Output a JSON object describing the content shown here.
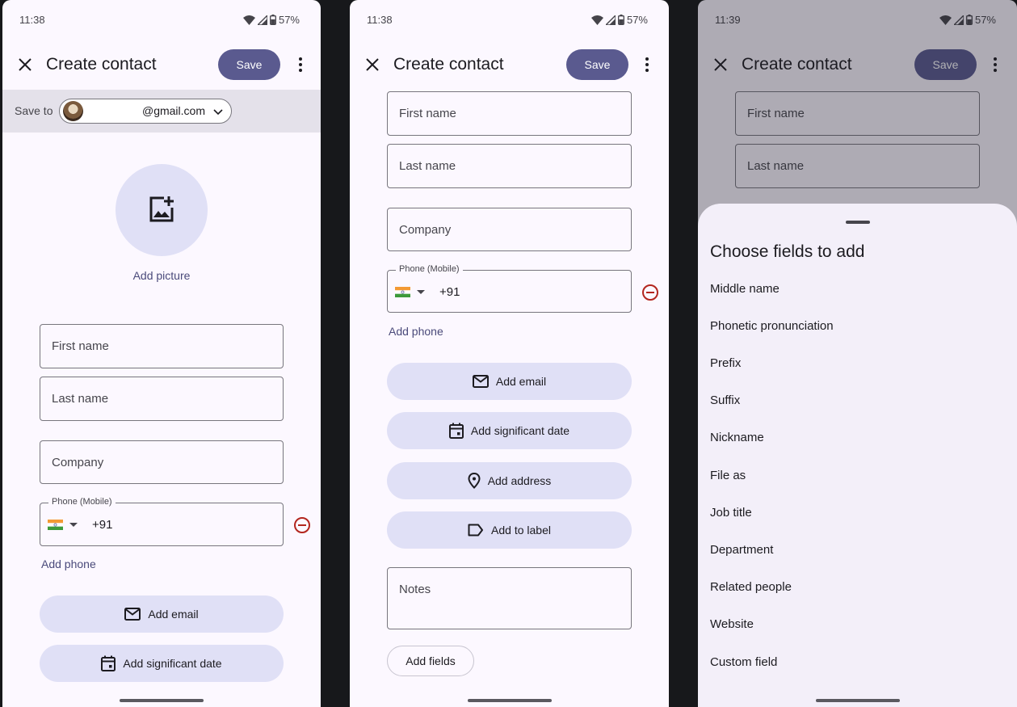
{
  "screens": [
    {
      "status": {
        "time": "11:38",
        "battery": "57%"
      },
      "appbar": {
        "title": "Create contact",
        "save_label": "Save"
      },
      "save_to": {
        "label": "Save to",
        "account": "@gmail.com"
      },
      "add_picture_label": "Add picture",
      "fields": {
        "first_name_placeholder": "First name",
        "last_name_placeholder": "Last name",
        "company_placeholder": "Company",
        "phone_label": "Phone (Mobile)",
        "phone_country_code": "+91"
      },
      "add_phone_label": "Add phone",
      "buttons": {
        "add_email": "Add email",
        "add_significant_date": "Add significant date"
      }
    },
    {
      "status": {
        "time": "11:38",
        "battery": "57%"
      },
      "appbar": {
        "title": "Create contact",
        "save_label": "Save"
      },
      "fields": {
        "first_name_placeholder": "First name",
        "last_name_placeholder": "Last name",
        "company_placeholder": "Company",
        "phone_label": "Phone (Mobile)",
        "phone_country_code": "+91",
        "notes_placeholder": "Notes"
      },
      "add_phone_label": "Add phone",
      "buttons": {
        "add_email": "Add email",
        "add_significant_date": "Add significant date",
        "add_address": "Add address",
        "add_to_label": "Add to label",
        "add_fields": "Add fields"
      }
    },
    {
      "status": {
        "time": "11:39",
        "battery": "57%"
      },
      "appbar": {
        "title": "Create contact",
        "save_label": "Save"
      },
      "fields": {
        "first_name_placeholder": "First name",
        "last_name_placeholder": "Last name"
      },
      "sheet": {
        "title": "Choose fields to add",
        "options": [
          "Middle name",
          "Phonetic pronunciation",
          "Prefix",
          "Suffix",
          "Nickname",
          "File as",
          "Job title",
          "Department",
          "Related people",
          "Website",
          "Custom field"
        ]
      }
    }
  ],
  "colors": {
    "primary": "#5a5a8f",
    "tonal_container": "#e0e0f6",
    "surface": "#fcf8ff",
    "remove_red": "#b3261e"
  }
}
